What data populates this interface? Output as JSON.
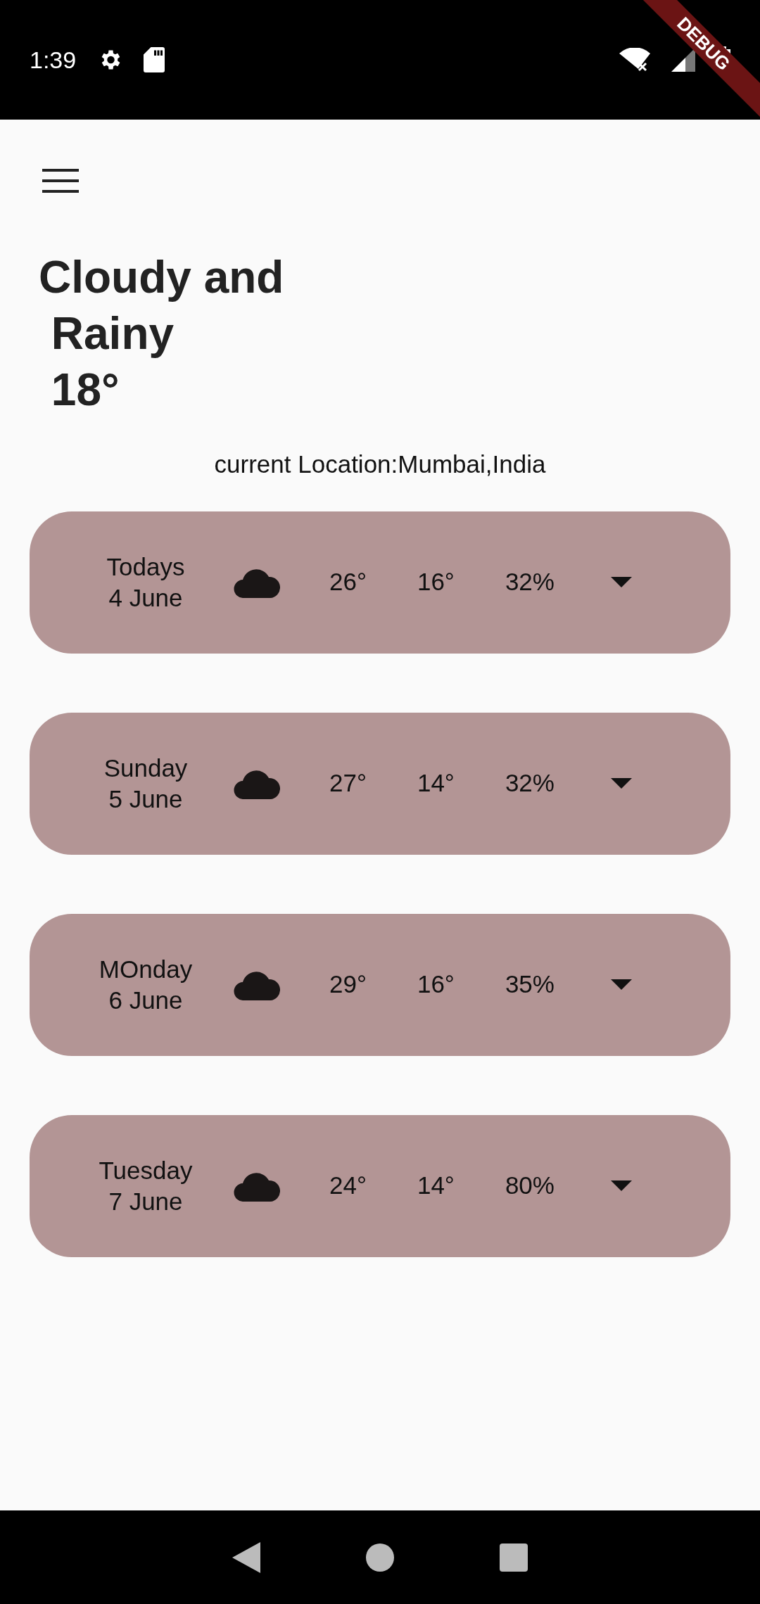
{
  "status_bar": {
    "time": "1:39"
  },
  "debug_banner": "DEBUG",
  "headline": {
    "lines": [
      "Cloudy and",
      " Rainy",
      " 18°"
    ]
  },
  "location": "current Location:Mumbai,India",
  "forecast": [
    {
      "day": "Todays",
      "date": "4 June",
      "high": "26°",
      "low": "16°",
      "humidity": "32%"
    },
    {
      "day": "Sunday",
      "date": "5 June",
      "high": "27°",
      "low": "14°",
      "humidity": "32%"
    },
    {
      "day": "MOnday",
      "date": "6 June",
      "high": "29°",
      "low": "16°",
      "humidity": "35%"
    },
    {
      "day": "Tuesday",
      "date": "7 June",
      "high": "24°",
      "low": "14°",
      "humidity": "80%"
    }
  ]
}
